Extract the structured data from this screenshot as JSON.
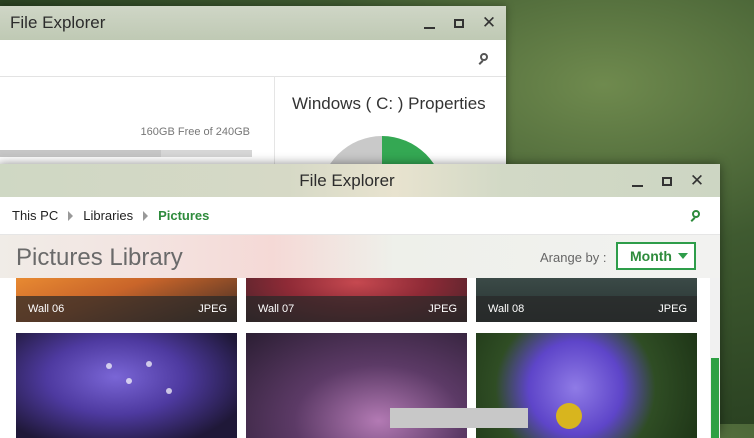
{
  "back_window": {
    "title": "File Explorer",
    "free_space_text": "160GB Free of 240GB",
    "properties_title": "Windows ( C: ) Properties",
    "used_fraction": 0.64
  },
  "front_window": {
    "title": "File Explorer",
    "breadcrumb": [
      "This PC",
      "Libraries",
      "Pictures"
    ],
    "library_title": "Pictures Library",
    "arrange_label": "Arange by :",
    "arrange_value": "Month",
    "tiles": [
      {
        "name": "Wall 06",
        "type": "JPEG"
      },
      {
        "name": "Wall 07",
        "type": "JPEG"
      },
      {
        "name": "Wall 08",
        "type": "JPEG"
      }
    ]
  },
  "colors": {
    "accent": "#2e9d4a"
  },
  "icons": [
    "minimize-icon",
    "maximize-icon",
    "close-icon",
    "search-icon",
    "chevron-right-icon",
    "dropdown-arrow-icon"
  ]
}
